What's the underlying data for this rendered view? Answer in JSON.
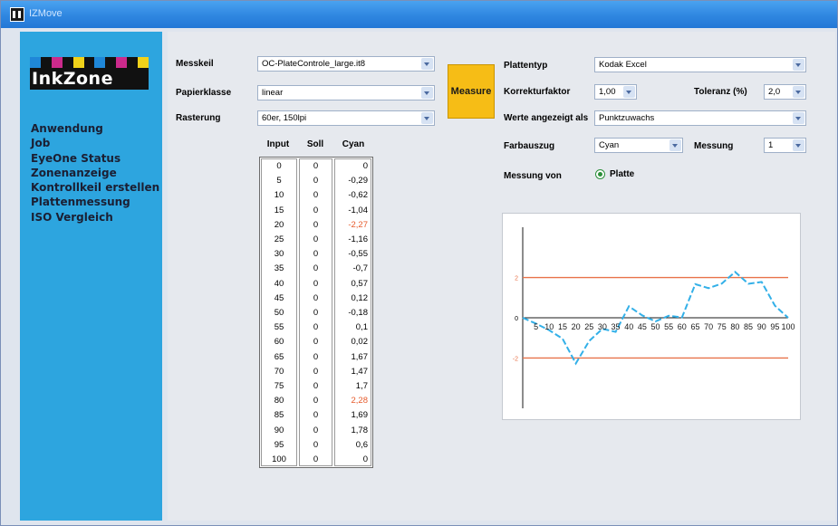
{
  "window": {
    "title": "IZMove"
  },
  "sidebar": {
    "logo_text": "InkZone",
    "logo_colors": [
      "#1f87d8",
      "#cc2a8c",
      "#f0d21a",
      "#111111"
    ],
    "nav": [
      "Anwendung",
      "Job",
      "EyeOne Status",
      "Zonenanzeige",
      "Kontrollkeil erstellen",
      "Plattenmessung",
      "ISO Vergleich"
    ]
  },
  "form": {
    "messkeil": {
      "label": "Messkeil",
      "value": "OC-PlateControle_large.it8"
    },
    "papierklasse": {
      "label": "Papierklasse",
      "value": "linear"
    },
    "rasterung": {
      "label": "Rasterung",
      "value": "60er, 150lpi"
    },
    "measure_button": "Measure",
    "plattentyp": {
      "label": "Plattentyp",
      "value": "Kodak Excel"
    },
    "korrekturfaktor": {
      "label": "Korrekturfaktor",
      "value": "1,00"
    },
    "toleranz": {
      "label": "Toleranz (%)",
      "value": "2,0"
    },
    "werte": {
      "label": "Werte angezeigt als",
      "value": "Punktzuwachs"
    },
    "farbauszug": {
      "label": "Farbauszug",
      "value": "Cyan"
    },
    "messung": {
      "label": "Messung",
      "value": "1"
    },
    "messung_von": {
      "label": "Messung von",
      "option": "Platte"
    }
  },
  "table": {
    "headers": [
      "Input",
      "Soll",
      "Cyan"
    ],
    "rows": [
      [
        "0",
        "0",
        "0"
      ],
      [
        "5",
        "0",
        "-0,29"
      ],
      [
        "10",
        "0",
        "-0,62"
      ],
      [
        "15",
        "0",
        "-1,04"
      ],
      [
        "20",
        "0",
        "-2,27"
      ],
      [
        "25",
        "0",
        "-1,16"
      ],
      [
        "30",
        "0",
        "-0,55"
      ],
      [
        "35",
        "0",
        "-0,7"
      ],
      [
        "40",
        "0",
        "0,57"
      ],
      [
        "45",
        "0",
        "0,12"
      ],
      [
        "50",
        "0",
        "-0,18"
      ],
      [
        "55",
        "0",
        "0,1"
      ],
      [
        "60",
        "0",
        "0,02"
      ],
      [
        "65",
        "0",
        "1,67"
      ],
      [
        "70",
        "0",
        "1,47"
      ],
      [
        "75",
        "0",
        "1,7"
      ],
      [
        "80",
        "0",
        "2,28"
      ],
      [
        "85",
        "0",
        "1,69"
      ],
      [
        "90",
        "0",
        "1,78"
      ],
      [
        "95",
        "0",
        "0,6"
      ],
      [
        "100",
        "0",
        "0"
      ]
    ],
    "highlight_rows": [
      4,
      16
    ],
    "highlight_color": "#e65a2b"
  },
  "chart_data": {
    "type": "line",
    "x": [
      0,
      5,
      10,
      15,
      20,
      25,
      30,
      35,
      40,
      45,
      50,
      55,
      60,
      65,
      70,
      75,
      80,
      85,
      90,
      95,
      100
    ],
    "x_tick_labels": [
      "5",
      "10",
      "15",
      "20",
      "25",
      "30",
      "35",
      "40",
      "45",
      "50",
      "55",
      "60",
      "65",
      "70",
      "75",
      "80",
      "85",
      "90",
      "95",
      "100"
    ],
    "series": [
      {
        "values": [
          0,
          -0.29,
          -0.62,
          -1.04,
          -2.27,
          -1.16,
          -0.55,
          -0.7,
          0.57,
          0.12,
          -0.18,
          0.1,
          0.02,
          1.67,
          1.47,
          1.7,
          2.28,
          1.69,
          1.78,
          0.6,
          0
        ],
        "color": "#33b0e8"
      }
    ],
    "reference_lines": [
      2,
      -2
    ],
    "reference_color": "#e8734a",
    "y_tick_labels": [
      "2",
      "0",
      "-2"
    ],
    "ylim": [
      -4.5,
      4.5
    ],
    "xlim": [
      0,
      100
    ],
    "grid": false
  }
}
